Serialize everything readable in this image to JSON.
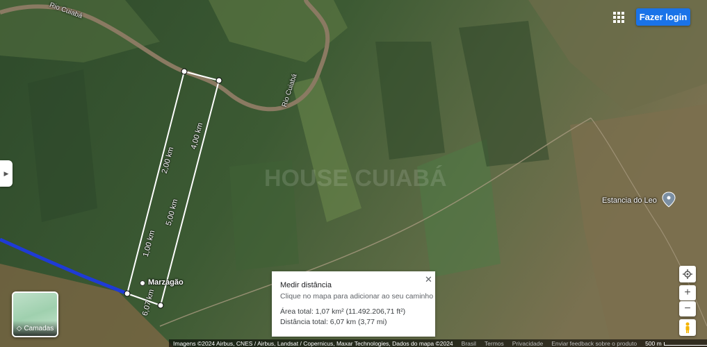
{
  "header": {
    "login_label": "Fazer login"
  },
  "map_labels": {
    "river_top": "Rio Cuiabá",
    "river_right": "Rio Cuiabá",
    "place_marzagao": "Marzagão",
    "place_estancia": "Estancia do Leo",
    "watermark": "HOUSE CUIABÁ"
  },
  "measure_labels": {
    "km1": "1,00 km",
    "km2": "2,00 km",
    "km4": "4,00 km",
    "km5": "5,00 km",
    "km6": "6,07 km"
  },
  "layers_button": {
    "label": "Camadas"
  },
  "measure_panel": {
    "title": "Medir distância",
    "hint": "Clique no mapa para adicionar ao seu caminho",
    "area": "Área total: 1,07 km² (11.492.206,71 ft²)",
    "distance": "Distância total: 6,07 km (3,77 mi)"
  },
  "attribution": {
    "imagery": "Imagens ©2024 Airbus, CNES / Airbus, Landsat / Copernicus, Maxar Technologies, Dados do mapa ©2024",
    "country": "Brasil",
    "terms": "Termos",
    "privacy": "Privacidade",
    "feedback": "Enviar feedback sobre o produto",
    "scale": "500 m"
  },
  "icons": [
    "apps-grid-icon",
    "expand-panel-icon",
    "layers-icon",
    "close-icon",
    "my-location-icon",
    "zoom-in-icon",
    "zoom-out-icon",
    "pegman-icon",
    "place-pin-icon"
  ],
  "colors": {
    "accent": "#1a73e8",
    "route": "#1f3bd6"
  }
}
